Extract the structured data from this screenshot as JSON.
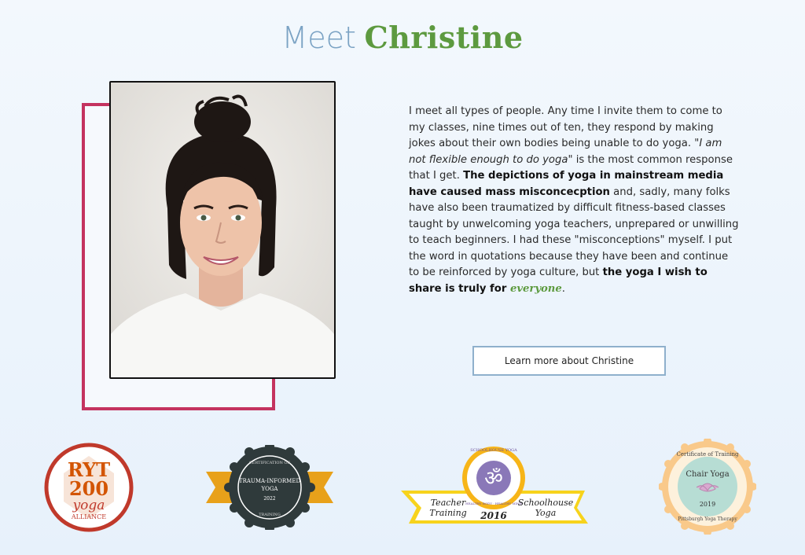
{
  "heading": {
    "meet": "Meet",
    "name": "Christine"
  },
  "bio": {
    "p1": "I meet all types of people. Any time I invite them to come to my classes, nine times out of ten, they respond by making jokes about their own bodies being unable to do yoga. \"",
    "quote": "I am not flexible enough to do yoga",
    "p2": "\" is the most common response that I get. ",
    "bold1": "The depictions of yoga in mainstream media have caused mass misconcecption",
    "p3": " and, sadly, many folks have also been traumatized by difficult fitness-based classes taught by unwelcoming yoga teachers, unprepared or unwilling to teach beginners. I had these \"misconceptions\" myself. I put the word in quotations because they have been and continue to be reinforced by yoga culture, but ",
    "bold2": "the yoga I wish to share is truly for ",
    "everyone": "everyone",
    "end": "."
  },
  "cta": {
    "label": "Learn more about Christine"
  },
  "badges": {
    "ryt": {
      "line1": "RYT",
      "line2": "200",
      "line3": "yoga",
      "line4": "ALLIANCE"
    },
    "trauma": {
      "arc_top": "CERTIFICATION OF",
      "title1": "TRAUMA-INFORMED",
      "title2": "YOGA",
      "year": "2022",
      "arc_bottom": "TRAINING"
    },
    "schoolhouse": {
      "arc_top": "SCHOOLHOUSE YOGA",
      "arc_bottom": "HEALTHY BODY · HEALTHY MIND",
      "om": "ॐ",
      "left1": "Teacher",
      "left2": "Training",
      "year": "2016",
      "right1": "Schoolhouse",
      "right2": "Yoga"
    },
    "chair": {
      "arc_top": "Certificate of Training",
      "title": "Chair Yoga",
      "year": "2019",
      "arc_bottom": "Pittsburgh Yoga Therapy"
    }
  },
  "colors": {
    "green": "#5d9a3f",
    "blue": "#7ba3c4",
    "magenta": "#c4335f",
    "button_border": "#8fb0cc"
  }
}
